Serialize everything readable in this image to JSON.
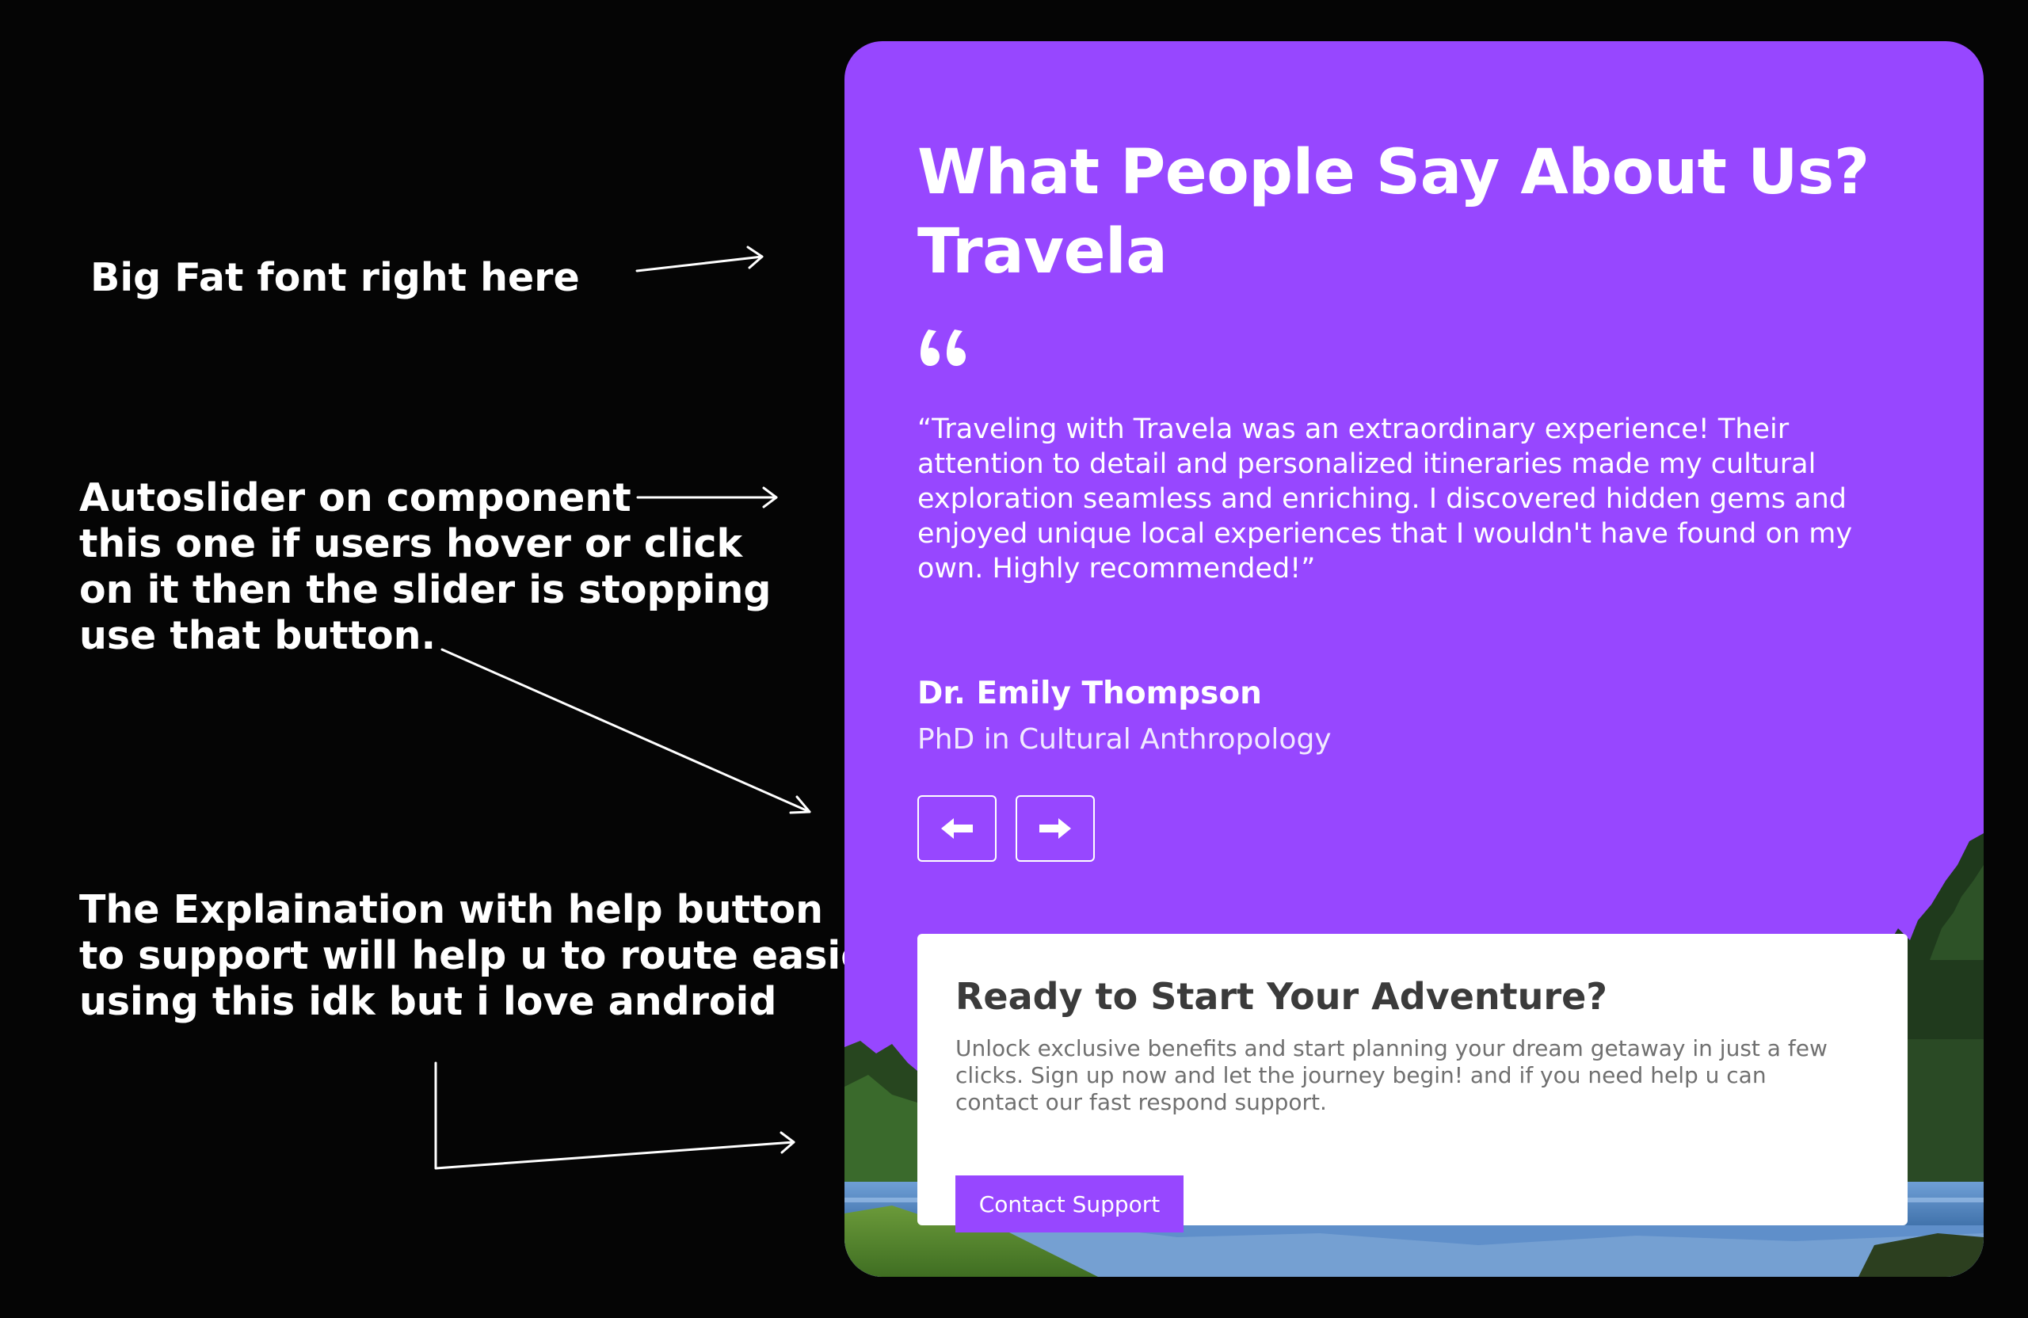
{
  "annotations": {
    "note_heading": "Big Fat font right here",
    "note_slider": "Autoslider on component\nthis one if users hover or click\non it then the slider is stopping\nuse that button.",
    "note_support": "The Explaination with help button\nto support will help u to route easier\nusing this idk but i love android"
  },
  "card": {
    "headline_line1": "What People Say About Us?",
    "headline_line2": "Travela",
    "quote_icon": "quote-icon",
    "testimonial": "“Traveling with Travela was an extraordinary experience! Their attention to detail and personalized itineraries made my cultural exploration seamless and enriching. I discovered hidden gems and enjoyed unique local experiences that I wouldn't have found on my own. Highly recommended!”",
    "author_name": "Dr. Emily Thompson",
    "author_title": "PhD in Cultural Anthropology",
    "prev_icon": "arrow-left-icon",
    "next_icon": "arrow-right-icon"
  },
  "cta": {
    "title": "Ready to Start Your Adventure?",
    "text": "Unlock exclusive benefits and start planning your dream getaway in just a few clicks. Sign up now and let the journey begin! and if you need help u can contact our fast respond support.",
    "button_label": "Contact Support"
  },
  "colors": {
    "background": "#050505",
    "accent": "#9747ff",
    "cta_title": "#3b3b3b",
    "cta_text": "#707070",
    "white": "#ffffff"
  }
}
